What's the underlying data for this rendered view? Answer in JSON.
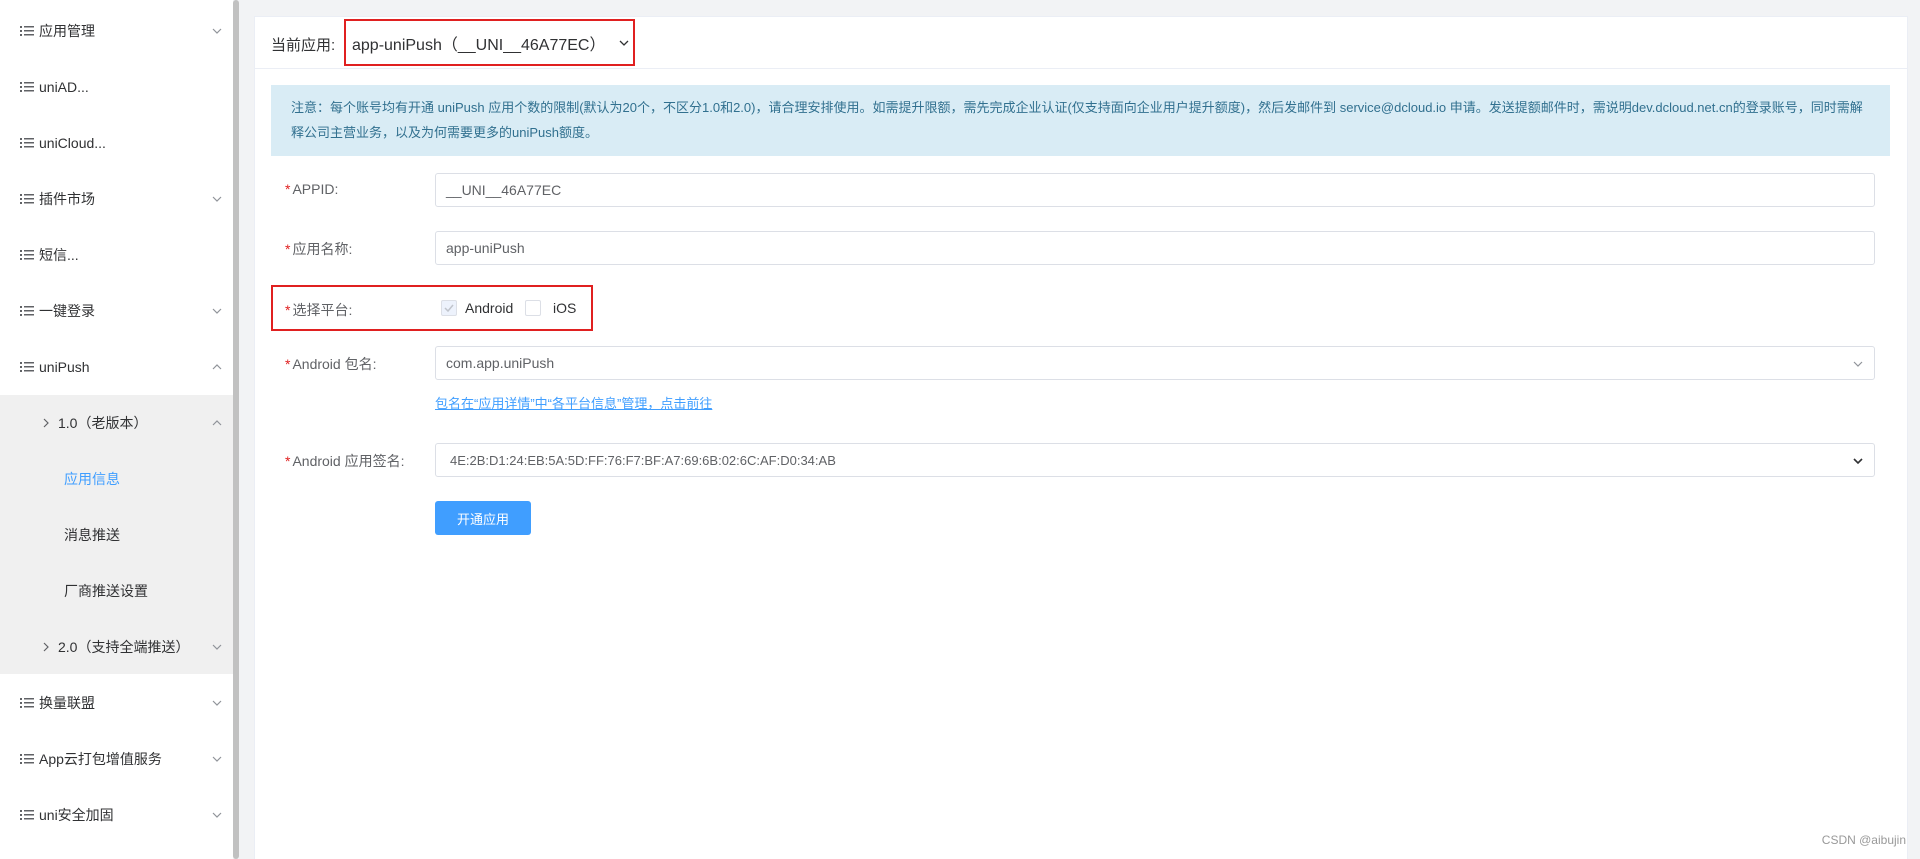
{
  "sidebar": {
    "items": [
      {
        "label": "应用管理",
        "expandable": true
      },
      {
        "label": "uniAD...",
        "expandable": false
      },
      {
        "label": "uniCloud...",
        "expandable": false
      },
      {
        "label": "插件市场",
        "expandable": true
      },
      {
        "label": "短信...",
        "expandable": false
      },
      {
        "label": "一键登录",
        "expandable": true
      },
      {
        "label": "uniPush",
        "expandable": true,
        "expanded": true
      },
      {
        "label": "换量联盟",
        "expandable": true
      },
      {
        "label": "App云打包增值服务",
        "expandable": true
      },
      {
        "label": "uni安全加固",
        "expandable": true
      }
    ],
    "unipush_children": [
      {
        "label": "1.0（老版本）",
        "expanded": true
      },
      {
        "label": "应用信息",
        "active": true
      },
      {
        "label": "消息推送"
      },
      {
        "label": "厂商推送设置"
      },
      {
        "label": "2.0（支持全端推送）",
        "expanded": false
      }
    ]
  },
  "header": {
    "current_app_label": "当前应用:",
    "current_app_value": "app-uniPush（__UNI__46A77EC）"
  },
  "notice": {
    "text": "注意：每个账号均有开通 uniPush 应用个数的限制(默认为20个，不区分1.0和2.0)，请合理安排使用。如需提升限额，需先完成企业认证(仅支持面向企业用户提升额度)，然后发邮件到 service@dcloud.io 申请。发送提额邮件时，需说明dev.dcloud.net.cn的登录账号，同时需解释公司主营业务，以及为何需要更多的uniPush额度。"
  },
  "form": {
    "required_mark": "*",
    "appid_label": "APPID:",
    "appid_value": "__UNI__46A77EC",
    "appname_label": "应用名称:",
    "appname_value": "app-uniPush",
    "platform_label": "选择平台:",
    "platform_android": "Android",
    "platform_ios": "iOS",
    "android_pkg_label": "Android 包名:",
    "android_pkg_value": "com.app.uniPush",
    "pkg_link": "包名在“应用详情”中“各平台信息”管理，点击前往",
    "android_sign_label": "Android 应用签名:",
    "android_sign_value": "4E:2B:D1:24:EB:5A:5D:FF:76:F7:BF:A7:69:6B:02:6C:AF:D0:34:AB",
    "submit_label": "开通应用"
  },
  "watermark": "CSDN @aibujin",
  "colors": {
    "primary": "#409eff",
    "highlight": "#e02020",
    "notice_bg": "#d9ecf5",
    "notice_text": "#31708f"
  }
}
